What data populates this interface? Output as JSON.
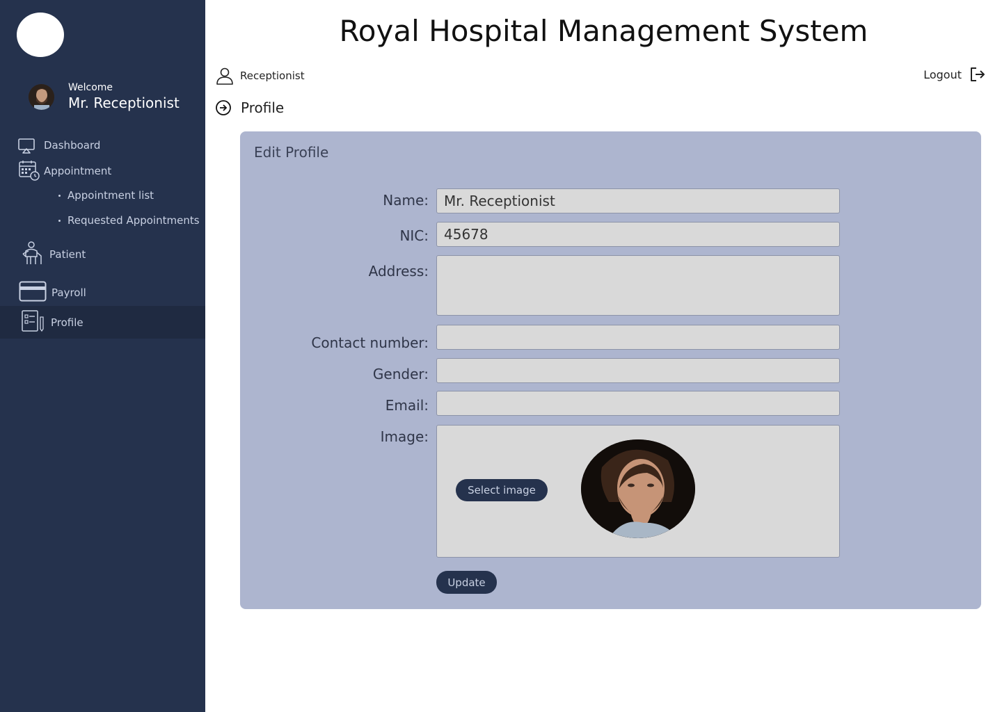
{
  "app": {
    "title": "Royal Hospital Management System"
  },
  "sidebar": {
    "welcome_small": "Welcome",
    "welcome_name": "Mr. Receptionist",
    "items": [
      {
        "label": "Dashboard",
        "icon": "dashboard-icon"
      },
      {
        "label": "Appointment",
        "icon": "calendar-icon"
      },
      {
        "label": "Patient",
        "icon": "patient-icon"
      },
      {
        "label": "Payroll",
        "icon": "card-icon"
      },
      {
        "label": "Profile",
        "icon": "profile-list-icon",
        "active": true
      }
    ],
    "subitems": [
      {
        "label": "Appointment list"
      },
      {
        "label": "Requested Appointments"
      }
    ]
  },
  "header": {
    "role": "Receptionist",
    "logout": "Logout",
    "breadcrumb": "Profile"
  },
  "form": {
    "title": "Edit Profile",
    "name_label": "Name:",
    "name_value": "Mr. Receptionist",
    "nic_label": "NIC:",
    "nic_value": "45678",
    "address_label": "Address:",
    "address_value": "",
    "contact_label": "Contact  number:",
    "contact_value": "",
    "gender_label": "Gender:",
    "gender_value": "",
    "email_label": "Email:",
    "email_value": "",
    "image_label": "Image:",
    "select_image": "Select image",
    "update": "Update"
  },
  "colors": {
    "sidebar_bg": "#25324d",
    "sidebar_active": "#1f2a41",
    "card_bg": "#adb5cf",
    "field_bg": "#d9d9d9",
    "button_bg": "#25324d"
  }
}
